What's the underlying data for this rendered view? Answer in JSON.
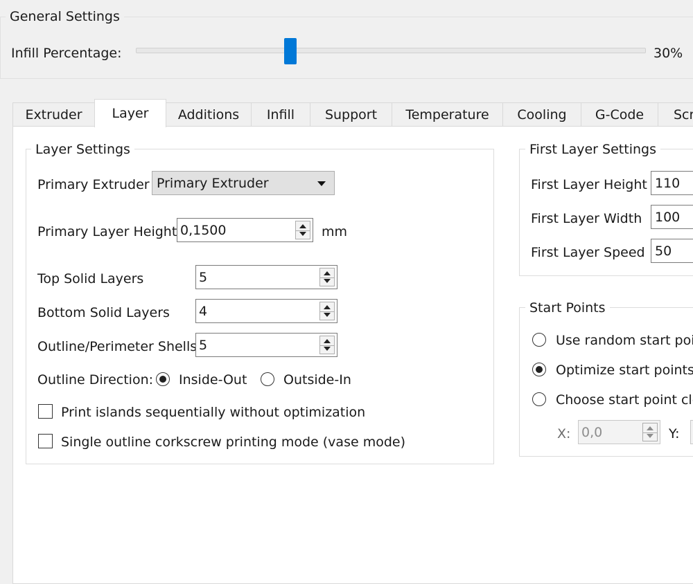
{
  "general": {
    "title": "General Settings",
    "infill_label": "Infill Percentage:",
    "infill_value": "30%",
    "infill_fraction": 0.3
  },
  "tabs": [
    {
      "label": "Extruder",
      "active": false
    },
    {
      "label": "Layer",
      "active": true
    },
    {
      "label": "Additions",
      "active": false
    },
    {
      "label": "Infill",
      "active": false
    },
    {
      "label": "Support",
      "active": false
    },
    {
      "label": "Temperature",
      "active": false
    },
    {
      "label": "Cooling",
      "active": false
    },
    {
      "label": "G-Code",
      "active": false
    },
    {
      "label": "Scr",
      "active": false
    }
  ],
  "layer_settings": {
    "title": "Layer Settings",
    "primary_extruder_label": "Primary Extruder",
    "primary_extruder_value": "Primary Extruder",
    "primary_layer_height_label": "Primary Layer Height",
    "primary_layer_height_value": "0,1500",
    "primary_layer_height_unit": "mm",
    "top_solid_label": "Top Solid Layers",
    "top_solid_value": "5",
    "bottom_solid_label": "Bottom Solid Layers",
    "bottom_solid_value": "4",
    "outline_shells_label": "Outline/Perimeter Shells",
    "outline_shells_value": "5",
    "outline_direction_label": "Outline Direction:",
    "inside_out_label": "Inside-Out",
    "outside_in_label": "Outside-In",
    "outline_direction_selected": "Inside-Out",
    "print_islands_label": "Print islands sequentially without optimization",
    "print_islands_checked": false,
    "vase_mode_label": "Single outline corkscrew printing mode (vase mode)",
    "vase_mode_checked": false
  },
  "first_layer": {
    "title": "First Layer Settings",
    "height_label": "First Layer Height",
    "height_value": "110",
    "width_label": "First Layer Width",
    "width_value": "100",
    "speed_label": "First Layer Speed",
    "speed_value": "50"
  },
  "start_points": {
    "title": "Start Points",
    "option_random": "Use random start poin",
    "option_optimize": "Optimize start points f",
    "option_choose": "Choose start point clo",
    "selected": "Optimize start points f",
    "x_label": "X:",
    "x_value": "0,0",
    "y_label": "Y:"
  }
}
